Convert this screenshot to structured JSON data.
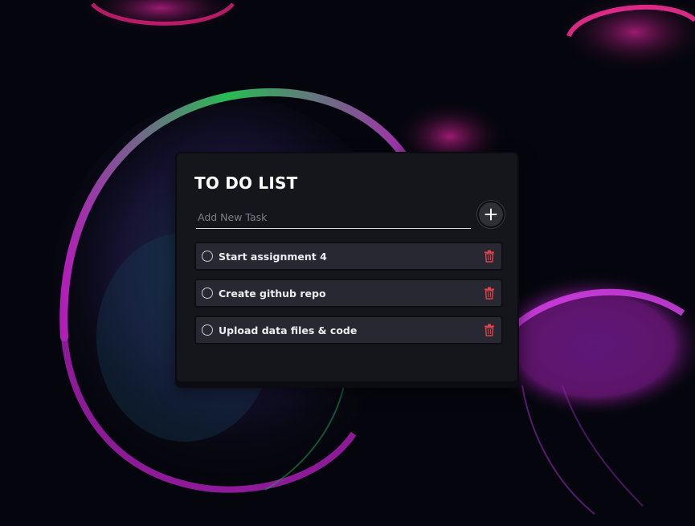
{
  "app": {
    "title": "TO DO LIST"
  },
  "input": {
    "placeholder": "Add New Task",
    "value": ""
  },
  "add_button": {
    "icon": "plus-icon"
  },
  "tasks": [
    {
      "label": "Start assignment 4",
      "done": false
    },
    {
      "label": "Create github repo",
      "done": false
    },
    {
      "label": "Upload data files & code",
      "done": false
    }
  ],
  "icons": {
    "checkbox": "circle-icon",
    "delete": "trash-icon"
  },
  "colors": {
    "background": "#05060d",
    "card": "#15161c",
    "task_item": "#272831",
    "text": "#ededf1",
    "delete": "#e0414c"
  }
}
